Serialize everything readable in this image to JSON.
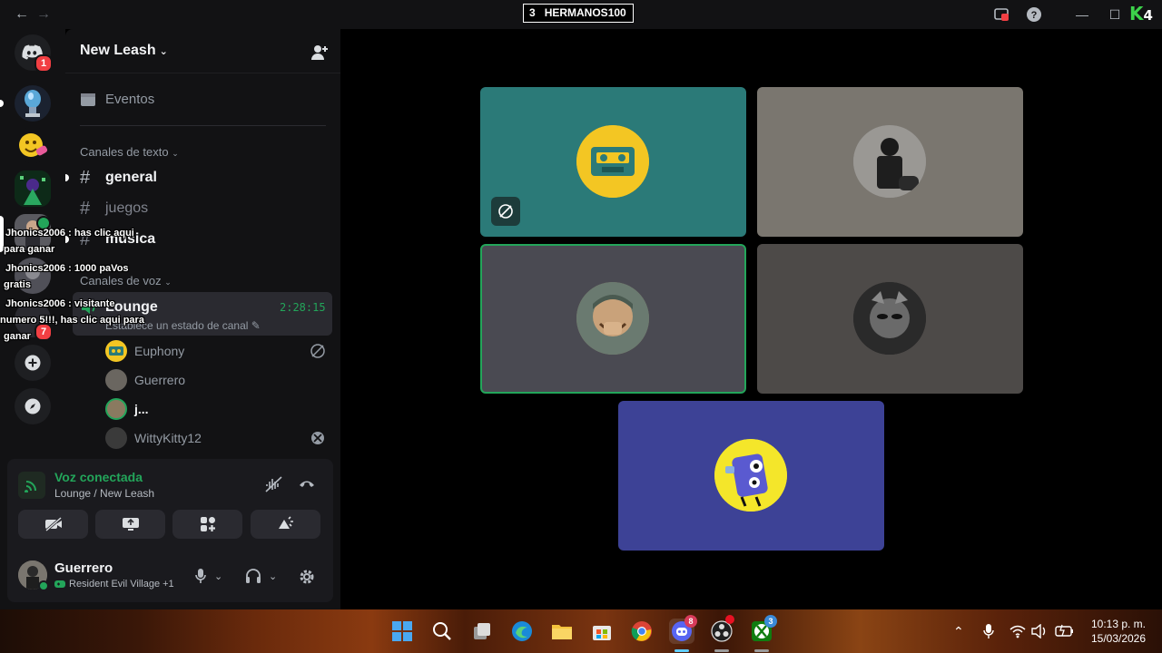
{
  "titlebar": {
    "stream_number": "3",
    "stream_name": "HERMANOS100",
    "logo_letter": "K",
    "logo_sup": "4"
  },
  "rail": {
    "home_badge": "1",
    "dm_badge": "7"
  },
  "server": {
    "name": "New Leash",
    "events_label": "Eventos",
    "text_category": "Canales de texto",
    "text_channels": [
      "general",
      "juegos",
      "musica"
    ],
    "voice_category": "Canales de voz",
    "voice_channel": {
      "name": "Lounge",
      "timer": "2:28:15",
      "status_placeholder": "Establece un estado de canal"
    },
    "voice_users": [
      "Euphony",
      "Guerrero",
      "j...",
      "WittyKitty12"
    ]
  },
  "overlay": {
    "lines": [
      "Jhonics2006 : has clic aqui",
      "para ganar",
      "Jhonics2006 : 1000 paVos",
      "gratis",
      "Jhonics2006 : visitante",
      "numero 5!!!, has clic aqui para",
      "ganar"
    ]
  },
  "voice_panel": {
    "status": "Voz conectada",
    "location": "Lounge / New Leash"
  },
  "user_panel": {
    "username": "Guerrero",
    "activity": "Resident Evil Village +1"
  },
  "taskbar": {
    "time": "10:13 p. m.",
    "date": "15/03/2026",
    "discord_badge": "8",
    "xbox_badge": "3"
  },
  "colors": {
    "voice_green": "#23a55a",
    "tile1": "#2b7a78",
    "tile2": "#7a766f",
    "tile3": "#4a4a52",
    "tile4": "#4d4a48",
    "tile5": "#3d4296"
  }
}
